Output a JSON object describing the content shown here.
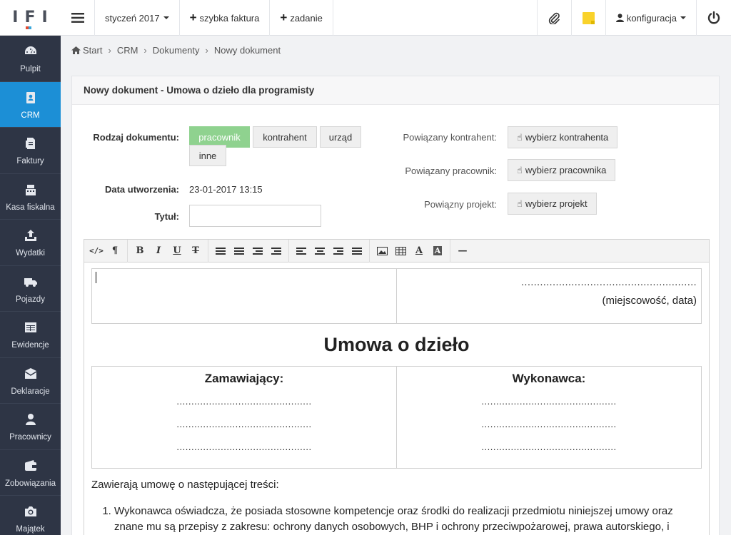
{
  "app": {
    "logo": "IFI"
  },
  "sidebar": {
    "items": [
      {
        "label": "Pulpit",
        "icon": "dashboard-icon",
        "active": false
      },
      {
        "label": "CRM",
        "icon": "contacts-book-icon",
        "active": true
      },
      {
        "label": "Faktury",
        "icon": "invoice-icon",
        "active": false
      },
      {
        "label": "Kasa fiskalna",
        "icon": "cash-register-icon",
        "active": false
      },
      {
        "label": "Wydatki",
        "icon": "upload-tray-icon",
        "active": false
      },
      {
        "label": "Pojazdy",
        "icon": "truck-icon",
        "active": false
      },
      {
        "label": "Ewidencje",
        "icon": "table-icon",
        "active": false
      },
      {
        "label": "Deklaracje",
        "icon": "envelope-icon",
        "active": false
      },
      {
        "label": "Pracownicy",
        "icon": "user-icon",
        "active": false
      },
      {
        "label": "Zobowiązania",
        "icon": "wallet-icon",
        "active": false
      },
      {
        "label": "Majątek",
        "icon": "camera-icon",
        "active": false
      }
    ]
  },
  "topbar": {
    "period": "styczeń 2017",
    "quick_invoice": "szybka faktura",
    "task": "zadanie",
    "config": "konfiguracja"
  },
  "breadcrumb": [
    "Start",
    "CRM",
    "Dokumenty",
    "Nowy dokument"
  ],
  "panel": {
    "title": "Nowy dokument - Umowa o dzieło dla programisty",
    "doc_type_label": "Rodzaj dokumentu:",
    "doc_types": [
      "pracownik",
      "kontrahent",
      "urząd",
      "inne"
    ],
    "selected_doc_type": "pracownik",
    "created_label": "Data utworzenia:",
    "created_value": "23-01-2017 13:15",
    "title_label": "Tytuł:",
    "title_value": "",
    "linked_contractor_label": "Powiązany kontrahent:",
    "linked_contractor_button": "wybierz kontrahenta",
    "linked_employee_label": "Powiązany pracownik:",
    "linked_employee_button": "wybierz pracownika",
    "linked_project_label": "Powiązny projekt:",
    "linked_project_button": "wybierz projekt"
  },
  "editor": {
    "place_dots": "........................................................",
    "place_caption": "(miejscowość, data)",
    "doc_title": "Umowa o dzieło",
    "party_left": "Zamawiający:",
    "party_right": "Wykonawca:",
    "party_dots": "..............................................",
    "intro": "Zawierają umowę o następującej treści:",
    "point_1": "Wykonawca oświadcza, że posiada stosowne kompetencje oraz środki do realizacji przedmiotu niniejszej umowy oraz znane mu są przepisy z zakresu: ochrony danych osobowych, BHP i ochrony przeciwpożarowej, prawa autorskiego, i"
  }
}
